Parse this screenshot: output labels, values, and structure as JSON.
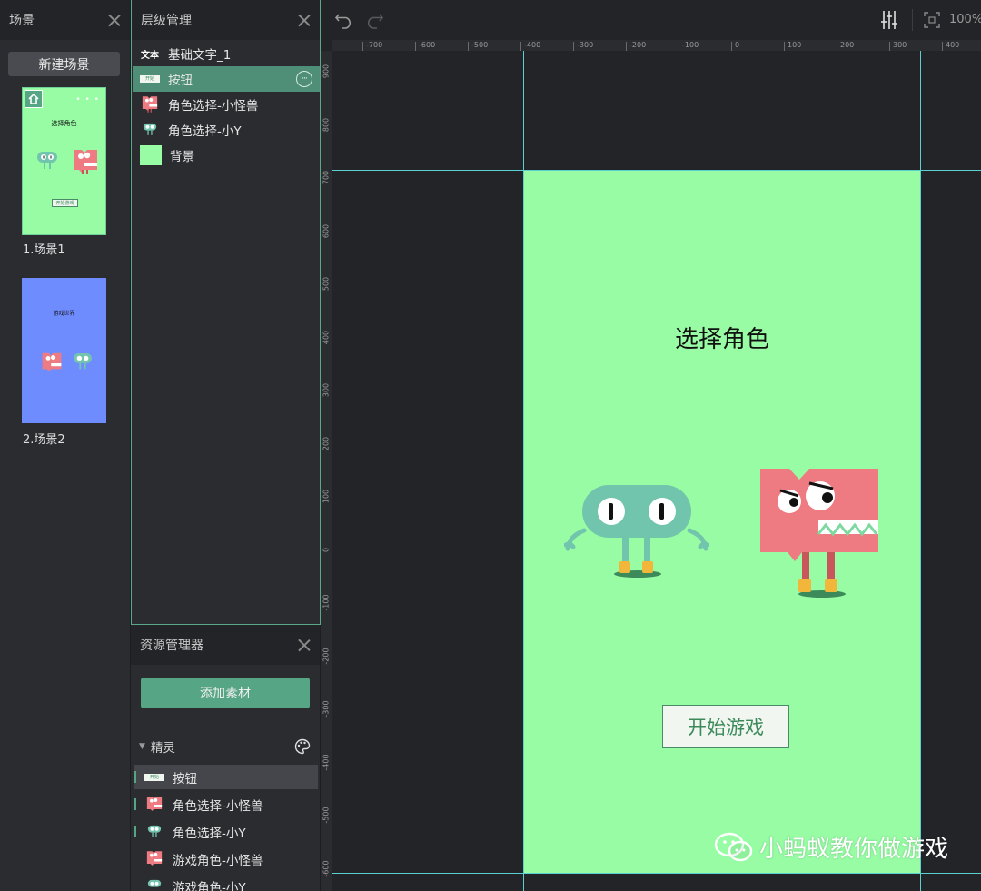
{
  "scenes_panel": {
    "title": "场景",
    "new_scene_label": "新建场景",
    "scenes": [
      {
        "label": "1.场景1",
        "thumb_title": "选择角色",
        "thumb_button": "开始游戏",
        "bg": "#97fca4"
      },
      {
        "label": "2.场景2",
        "thumb_title": "游戏世界",
        "bg": "#6f8cff"
      }
    ]
  },
  "layers_panel": {
    "title": "层级管理",
    "items": [
      {
        "label": "基础文字_1",
        "icon": "text-icon",
        "icon_text": "文本"
      },
      {
        "label": "按钮",
        "icon": "button-icon",
        "icon_text": "开始",
        "selected": true
      },
      {
        "label": "角色选择-小怪兽",
        "icon": "monster-icon"
      },
      {
        "label": "角色选择-小Y",
        "icon": "blob-icon"
      },
      {
        "label": "背景",
        "icon": "background-swatch"
      }
    ],
    "more_label": "···"
  },
  "assets_panel": {
    "title": "资源管理器",
    "add_label": "添加素材",
    "group_label": "精灵",
    "items": [
      {
        "label": "按钮",
        "icon": "button-icon",
        "icon_text": "开始",
        "selected": true
      },
      {
        "label": "角色选择-小怪兽",
        "icon": "monster-icon"
      },
      {
        "label": "角色选择-小Y",
        "icon": "blob-icon"
      },
      {
        "label": "游戏角色-小怪兽",
        "icon": "monster-icon"
      },
      {
        "label": "游戏角色-小Y",
        "icon": "blob-icon"
      }
    ]
  },
  "toolbar": {
    "zoom": "100%"
  },
  "rulers": {
    "top": [
      "-700",
      "-600",
      "-500",
      "-400",
      "-300",
      "-200",
      "-100",
      "0",
      "100",
      "200",
      "300",
      "400"
    ],
    "left": [
      "900",
      "800",
      "700",
      "600",
      "500",
      "400",
      "300",
      "200",
      "100",
      "0",
      "-100",
      "-200",
      "-300",
      "-400",
      "-500",
      "-600"
    ]
  },
  "stage": {
    "title": "选择角色",
    "button_label": "开始游戏",
    "bg": "#97fca4"
  },
  "watermark": "小蚂蚁教你做游戏",
  "colors": {
    "accent": "#56a585",
    "selection": "#4f8f78",
    "guide": "#5ad0d0",
    "monster": "#ee7b82",
    "blob": "#72c5ad"
  }
}
